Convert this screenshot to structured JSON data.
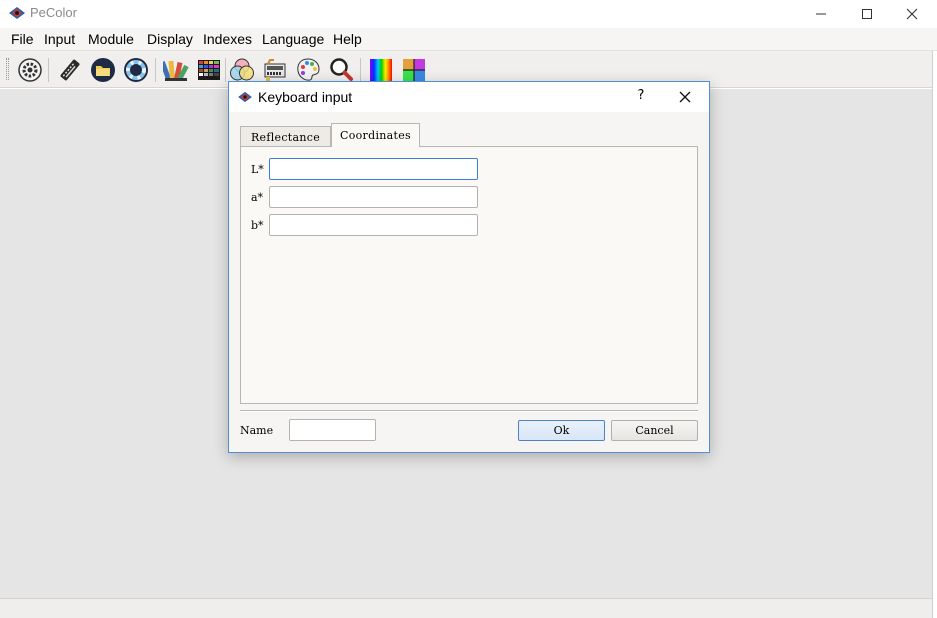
{
  "app": {
    "title": "PeColor"
  },
  "menu": [
    "File",
    "Input",
    "Module",
    "Display",
    "Indexes",
    "Language",
    "Help"
  ],
  "toolbar_icons": [
    "settings-gear-icon",
    "keyboard-icon",
    "folder-icon",
    "ring-icon",
    "color-fan-icon",
    "color-grid-icon",
    "color-circles-icon",
    "spectrometer-icon",
    "palette-icon",
    "magnifier-icon",
    "spectrum-icon",
    "color-wheel-icon"
  ],
  "dialog": {
    "title": "Keyboard input",
    "help_label": "?",
    "tabs": [
      {
        "label": "Reflectance",
        "active": false
      },
      {
        "label": "Coordinates",
        "active": true
      }
    ],
    "fields": [
      {
        "label": "L*",
        "value": ""
      },
      {
        "label": "a*",
        "value": ""
      },
      {
        "label": "b*",
        "value": ""
      }
    ],
    "name_label": "Name",
    "name_value": "",
    "ok_label": "Ok",
    "cancel_label": "Cancel"
  },
  "colors": {
    "accent": "#4f8fd6",
    "workspace": "#e5e5e5"
  }
}
